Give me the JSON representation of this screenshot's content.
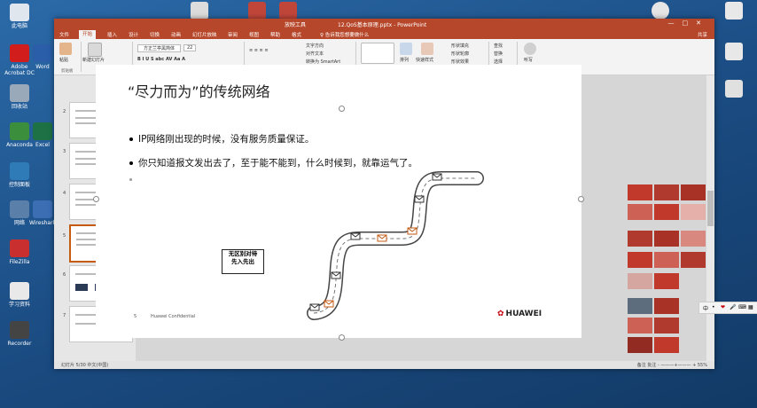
{
  "window": {
    "title": "12.QoS基本原理.pptx - PowerPoint",
    "subtitle": "放映工具",
    "controls": [
      "—",
      "□",
      "✕"
    ],
    "share": "共享"
  },
  "ribbon_tabs": [
    "文件",
    "开始",
    "插入",
    "设计",
    "切换",
    "动画",
    "幻灯片放映",
    "审阅",
    "视图",
    "帮助",
    "格式"
  ],
  "ribbon_tab_active": "开始",
  "tell_me": "♀ 告诉我您想要做什么",
  "ribbon": {
    "paste": "粘贴",
    "new_slide": "新建幻灯片",
    "font_name": "方正兰亭黑简体",
    "font_size": "22",
    "text_direction": "文字方向",
    "align_text": "对齐文本",
    "smartart": "转换为 SmartArt",
    "arrange": "排列",
    "quick_styles": "快速样式",
    "shape_fill": "形状填充",
    "shape_outline": "形状轮廓",
    "shape_effects": "形状效果",
    "find": "查找",
    "replace": "替换",
    "select": "选择",
    "voice": "听写",
    "groups": [
      "剪贴板",
      "幻灯片",
      "字体",
      "段落",
      "绘图",
      "编辑",
      "语音"
    ]
  },
  "thumbnails": [
    "2",
    "3",
    "4",
    "5",
    "6",
    "7"
  ],
  "selected_thumbnail": "6",
  "slide": {
    "title": "“尽力而为”的传统网络",
    "bullets": [
      "IP网络刚出现的时候，没有服务质量保证。",
      "你只知道报文发出去了，至于能不能到，什么时候到，就靠运气了。"
    ],
    "callout": [
      "无区别对待",
      "先入先出"
    ],
    "footer_page": "5",
    "footer_text": "Huawei Confidential",
    "logo_text": "HUAWEI"
  },
  "statusbar": {
    "left": "幻灯片 5/30   中文(中国)",
    "right": "备注   批注   -  ———+———  +  55%"
  },
  "ime": [
    "中",
    "•",
    "❤",
    "🎤",
    "⌨",
    "▦"
  ],
  "desktop_icons": [
    {
      "label": "此电脑"
    },
    {
      "label": "Adobe Acrobat DC"
    },
    {
      "label": "回收站"
    },
    {
      "label": "Anaconda"
    },
    {
      "label": "控制面板"
    },
    {
      "label": "网络"
    },
    {
      "label": "FileZilla"
    },
    {
      "label": "学习资料"
    },
    {
      "label": "Recorder"
    },
    {
      "label": "Word"
    },
    {
      "label": "Excel"
    },
    {
      "label": "Wireshark"
    }
  ],
  "colors": {
    "ppt_accent": "#b7472a",
    "huawei_red": "#c7000b",
    "desktop": "#1f4f86"
  }
}
